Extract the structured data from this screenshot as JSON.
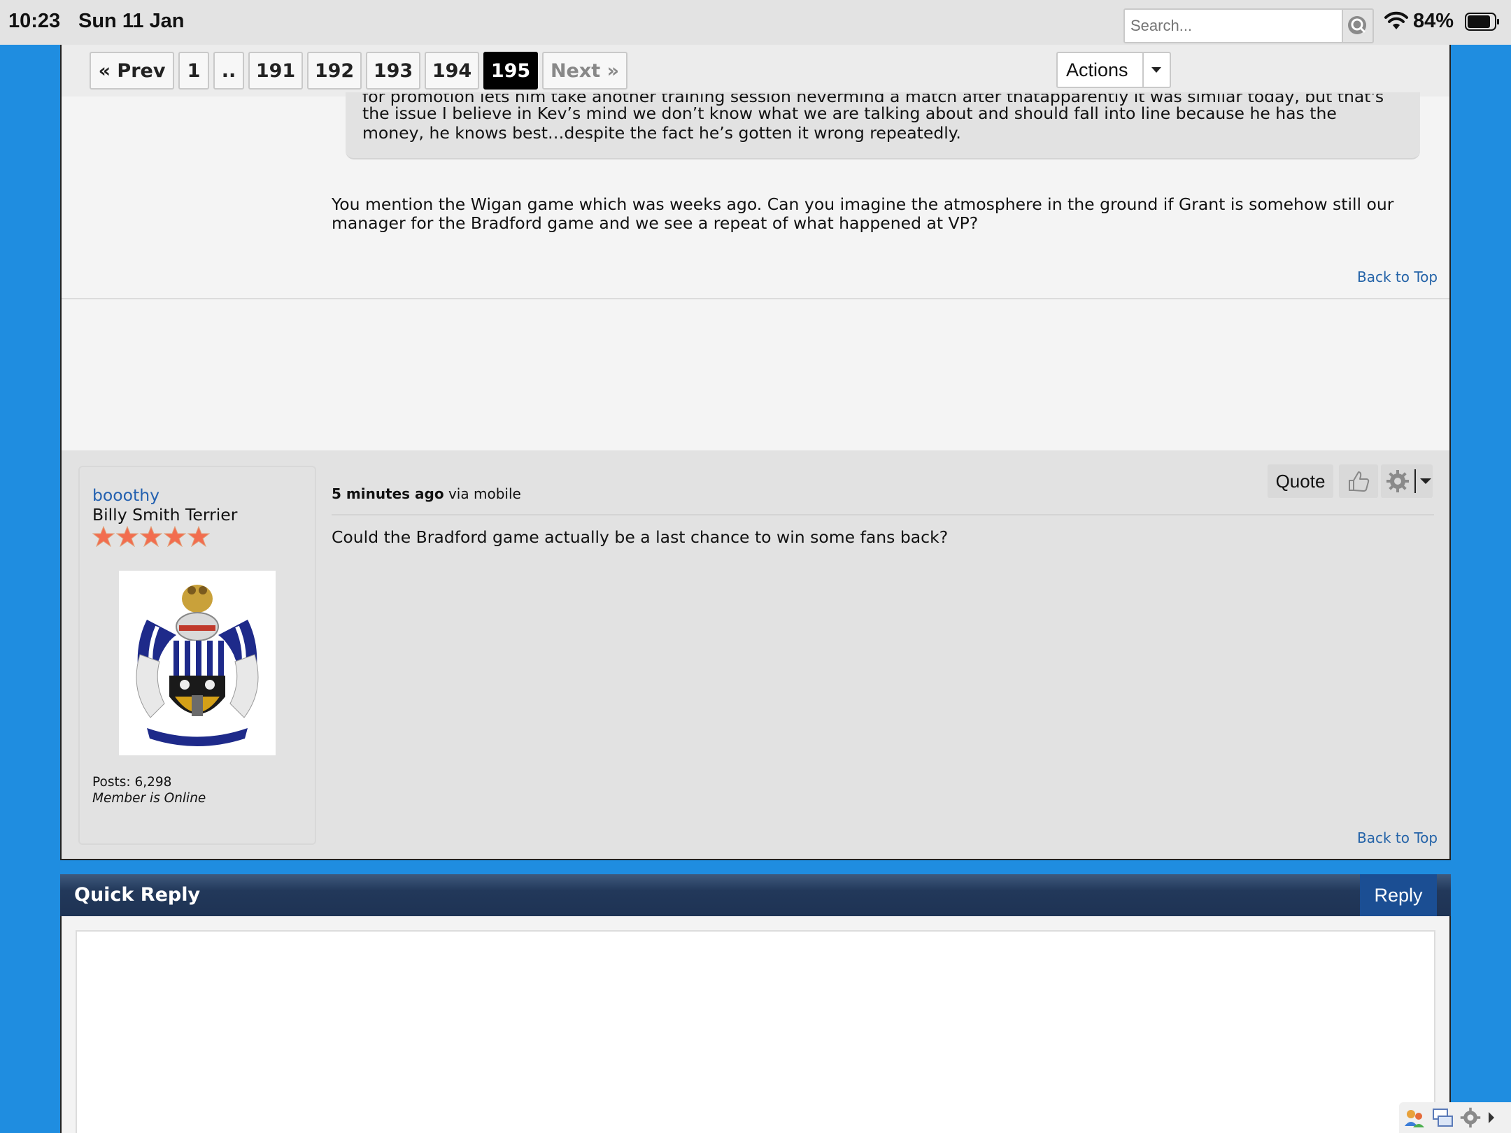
{
  "status_bar": {
    "time": "10:23",
    "date": "Sun 11 Jan",
    "battery_pct": "84%"
  },
  "pagination": {
    "prev": "« Prev",
    "first": "1",
    "ellipsis": "..",
    "pages": [
      "191",
      "192",
      "193",
      "194"
    ],
    "current": "195",
    "next": "Next »"
  },
  "toolbar": {
    "actions_label": "Actions",
    "search_placeholder": "Search..."
  },
  "quoted_post": {
    "lines": [
      "for promotion lets him take another training session nevermind a match after thatapparently it was similar today, but that's",
      "the issue I believe in Kev’s mind we don’t know what we are talking about and should fall into line because he has the",
      "money, he knows best…despite the fact he’s gotten it wrong repeatedly."
    ],
    "reply_lines": [
      "You mention the Wigan game which was weeks ago. Can you imagine the atmosphere in the ground if Grant is somehow still our",
      "manager for the Bradford game and we see a repeat of what happened at VP?"
    ],
    "back_to_top": "Back to Top"
  },
  "latest_post": {
    "username": "booothy",
    "user_title": "Billy Smith Terrier",
    "star_count": 5,
    "posts_label": "Posts: 6,298",
    "online_status": "Member is Online",
    "time_ago": "5 minutes ago",
    "via": "via mobile",
    "message": "Could the Bradford game actually be a last chance to win some fans back?",
    "quote_label": "Quote",
    "back_to_top": "Back to Top"
  },
  "quick_reply": {
    "title": "Quick Reply",
    "reply_label": "Reply"
  },
  "colors": {
    "page_bg": "#1f8de0",
    "link": "#2461b0",
    "header_dark": "#22385a",
    "reply_btn": "#1b4e93"
  }
}
